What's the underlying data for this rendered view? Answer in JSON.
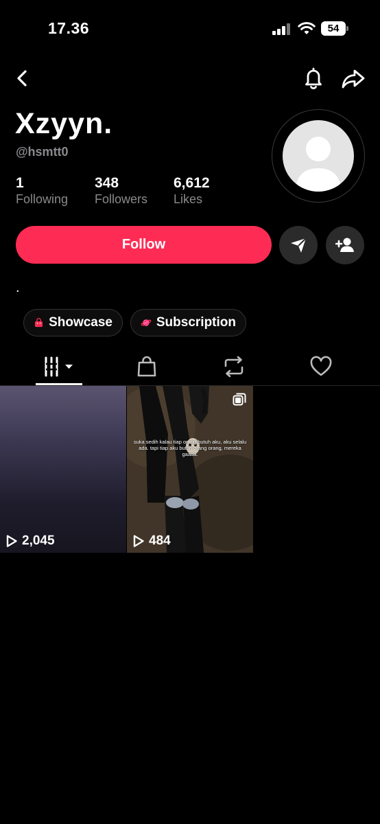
{
  "status_bar": {
    "time": "17.36",
    "battery": "54"
  },
  "profile": {
    "display_name": "Xzyyn.",
    "username": "@hsmtt0",
    "stats": {
      "following": {
        "value": "1",
        "label": "Following"
      },
      "followers": {
        "value": "348",
        "label": "Followers"
      },
      "likes": {
        "value": "6,612",
        "label": "Likes"
      }
    },
    "bio": "."
  },
  "actions": {
    "follow_label": "Follow"
  },
  "chips": {
    "showcase": "Showcase",
    "subscription": "Subscription"
  },
  "tabs": [
    "videos",
    "shop",
    "reposts",
    "liked"
  ],
  "videos": [
    {
      "views": "2,045"
    },
    {
      "views": "484",
      "caption": "suka sedih kalau tiap orang butuh aku, aku selalu ada. tapi tiap aku butuh orang orang, mereka gaada."
    }
  ],
  "colors": {
    "accent": "#fe2c55",
    "background": "#000000",
    "secondary_text": "#8a8a8e"
  }
}
